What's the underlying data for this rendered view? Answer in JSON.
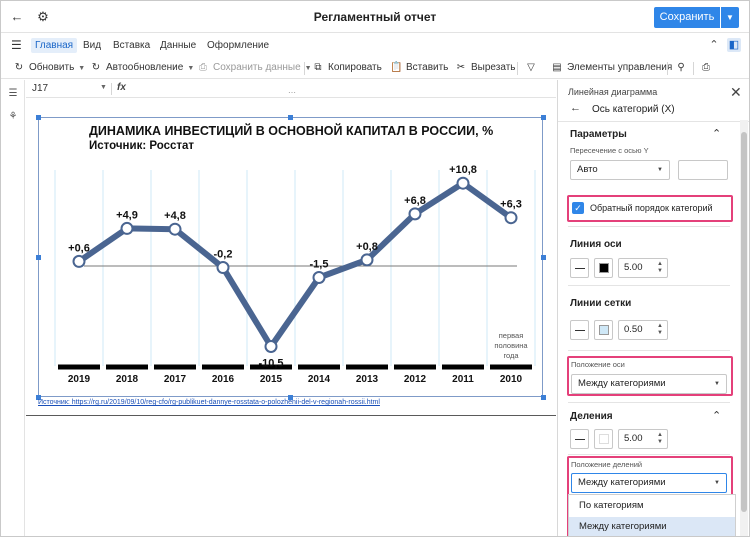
{
  "window": {
    "title": "Регламентный отчет",
    "save_label": "Сохранить"
  },
  "menu": [
    "Главная",
    "Вид",
    "Вставка",
    "Данные",
    "Оформление"
  ],
  "toolbar": {
    "refresh": "Обновить",
    "autorefresh": "Автообновление",
    "save_data": "Сохранить данные",
    "copy": "Копировать",
    "paste": "Вставить",
    "cut": "Вырезать",
    "controls": "Элементы управления"
  },
  "formula": {
    "cell_ref": "J17",
    "fx": "fx"
  },
  "chart_data": {
    "type": "line",
    "title": "ДИНАМИКА ИНВЕСТИЦИЙ В ОСНОВНОЙ КАПИТАЛ В РОССИИ, %",
    "subtitle": "Источник: Росстат",
    "categories": [
      "2019",
      "2018",
      "2017",
      "2016",
      "2015",
      "2014",
      "2013",
      "2012",
      "2011",
      "2010"
    ],
    "values": [
      0.6,
      4.9,
      4.8,
      -0.2,
      -10.5,
      -1.5,
      0.8,
      6.8,
      10.8,
      6.3
    ],
    "data_labels": [
      "+0,6",
      "+4,9",
      "+4,8",
      "-0,2",
      "-10,5",
      "-1,5",
      "+0,8",
      "+6,8",
      "+10,8",
      "+6,3"
    ],
    "category_note": "первая половина года",
    "ylim": [
      -12,
      12
    ],
    "grid": "vertical",
    "line_color": "#4a6591",
    "marker_fill": "#ffffff"
  },
  "source_link": "Источник: https://rg.ru/2019/09/10/reg-cfo/rg-publikuet-dannye-rosstata-o-polozhenii-del-v-regionah-rossii.html",
  "panel": {
    "header": "Линейная диаграмма",
    "subtitle": "Ось категорий (X)",
    "parameters_title": "Параметры",
    "crossing_label": "Пересечение с осью Y",
    "crossing_value": "Авто",
    "reverse_order_label": "Обратный порядок категорий",
    "axis_line_title": "Линия оси",
    "axis_line_color": "#000000",
    "axis_line_width": "5.00",
    "grid_lines_title": "Линии сетки",
    "grid_line_color": "#cfe8f7",
    "grid_line_width": "0.50",
    "axis_position_label": "Положение оси",
    "axis_position_value": "Между категориями",
    "ticks_title": "Деления",
    "ticks_width": "5.00",
    "ticks_position_label": "Положение делений",
    "ticks_position_value": "Между категориями",
    "ticks_options": [
      "По категориям",
      "Между категориями"
    ]
  },
  "colors": {
    "accent": "#2f86e8",
    "highlight": "#e4407a"
  }
}
